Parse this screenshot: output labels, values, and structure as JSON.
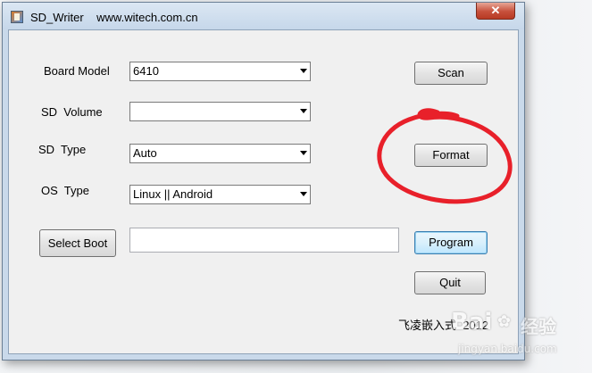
{
  "window": {
    "title": "SD_Writer    www.witech.com.cn",
    "close_glyph": "✕"
  },
  "form": {
    "board_model": {
      "label": "Board Model",
      "value": "6410"
    },
    "sd_volume": {
      "label": "SD  Volume",
      "value": ""
    },
    "sd_type": {
      "label": "SD  Type",
      "value": "Auto"
    },
    "os_type": {
      "label": "OS  Type",
      "value": "Linux || Android"
    },
    "boot_path": {
      "value": ""
    }
  },
  "buttons": {
    "select_boot": "Select Boot",
    "scan": "Scan",
    "format": "Format",
    "program": "Program",
    "quit": "Quit"
  },
  "footer": {
    "text": "飞凌嵌入式  2012"
  },
  "annotation": {
    "color": "#e8202a"
  },
  "watermark": {
    "brand": "Bai",
    "brand_suffix": "经验",
    "url": "jingyan.baidu.com"
  }
}
